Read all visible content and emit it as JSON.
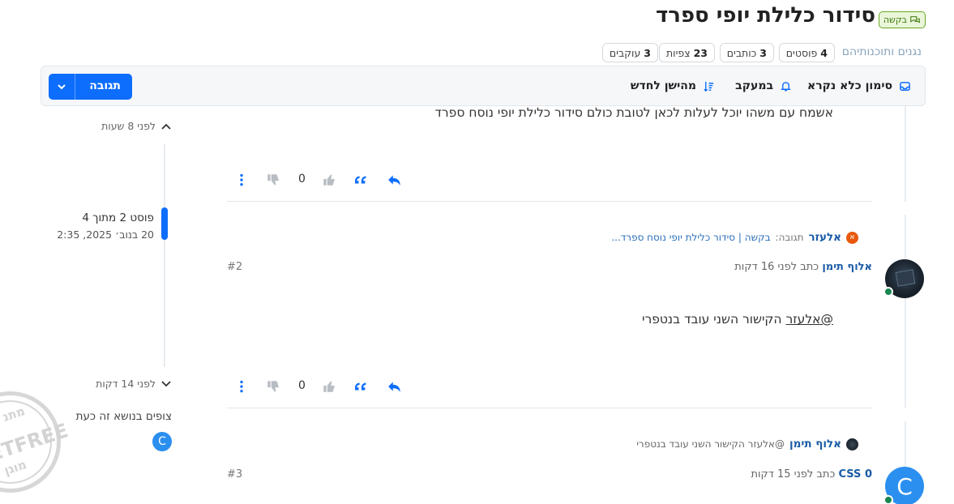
{
  "topic": {
    "title": "סידור כלילת יופי ספרד",
    "tag": "בקשה",
    "category": "נגנים ותוכנותיהם",
    "stats": [
      {
        "value": "4",
        "label": "פוסטים"
      },
      {
        "value": "3",
        "label": "כותבים"
      },
      {
        "value": "23",
        "label": "צפיות"
      },
      {
        "value": "3",
        "label": "עוקבים"
      }
    ]
  },
  "toolbar": {
    "mark_read": "סימון כלא נקרא",
    "tracking": "במעקב",
    "sort": "מהישן לחדש",
    "reply": "תגובה"
  },
  "nav": {
    "top_time": "לפני 8 שעות",
    "index": "פוסט 2 מתוך 4",
    "date": "20 בנוב׳ 2025, 2:35",
    "bottom_time": "לפני 14 דקות",
    "viewers_label": "צופים בנושא זה כעת",
    "viewer_initial": "C"
  },
  "posts": [
    {
      "text": "אשמח עם משהו יוכל לעלות לכאן לטובת כולם סידור כלילת יופי נוסח ספרד",
      "votes": "0"
    },
    {
      "parent_avatar": "א",
      "parent_author": "אלעזר",
      "parent_prefix": "תגובה:",
      "parent_content": "בקשה | סידור כלילת יופי נוסח ספרד...",
      "author": "אלוף תימן",
      "meta": "כתב לפני 16 דקות",
      "number": "#2",
      "mention": "@אלעזר",
      "text": "הקישור השני עובד בנטפרי",
      "votes": "0"
    },
    {
      "parent_author": "אלוף תימן",
      "parent_content": "@אלעזר הקישור השני עובד בנטפרי",
      "author": "CSS 0",
      "meta": "כתב לפני 15 דקות",
      "number": "#3",
      "avatar_initial": "C"
    }
  ],
  "watermark": {
    "top": "מתנ",
    "middle": "ETFREE",
    "bottom": "מוגן"
  },
  "colors": {
    "accent": "#0d6efd",
    "tag_border": "#6da526",
    "author": "#1a5ba6",
    "online": "#198754"
  }
}
